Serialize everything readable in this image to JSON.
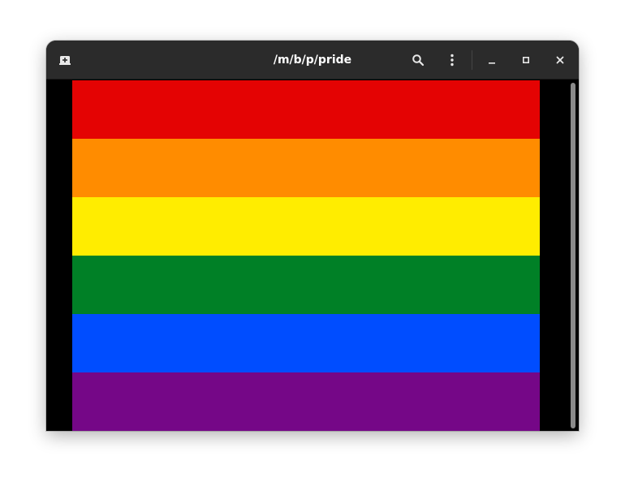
{
  "window": {
    "title": "/m/b/p/pride"
  },
  "headerbar": {
    "new_tab_icon": "tab-new-icon",
    "search_icon": "search-icon",
    "menu_icon": "kebab-menu-icon",
    "minimize_icon": "minimize-icon",
    "maximize_icon": "maximize-icon",
    "close_icon": "close-icon"
  },
  "flag": {
    "stripes": [
      {
        "name": "red",
        "color": "#E40303"
      },
      {
        "name": "orange",
        "color": "#FF8C00"
      },
      {
        "name": "yellow",
        "color": "#FFED00"
      },
      {
        "name": "green",
        "color": "#008026"
      },
      {
        "name": "blue",
        "color": "#004DFF"
      },
      {
        "name": "violet",
        "color": "#750787"
      }
    ]
  },
  "colors": {
    "headerbar_bg": "#2B2B2B",
    "viewport_bg": "#000000",
    "scrollbar": "#8A8A8A"
  }
}
